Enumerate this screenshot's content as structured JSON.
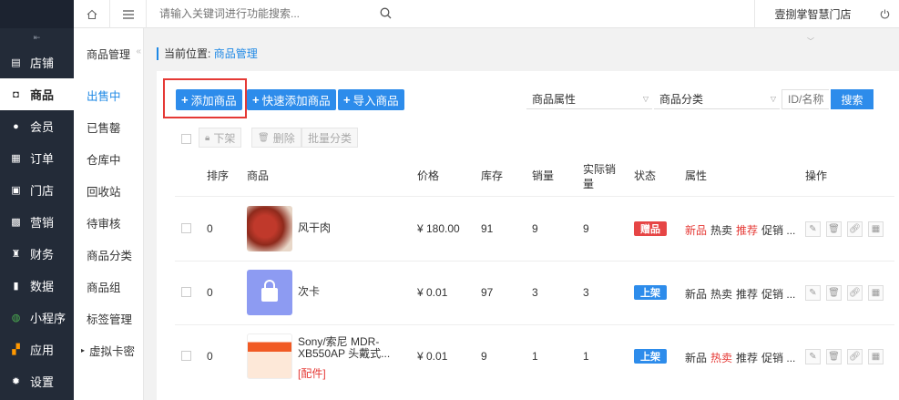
{
  "topbar": {
    "home_icon": "home-icon",
    "menu_icon": "hamburger-icon",
    "search_placeholder": "请输入关键词进行功能搜索...",
    "store_name": "壹捌掌智慧门店"
  },
  "sidebar": {
    "items": [
      {
        "label": "店铺",
        "icon": "store-icon"
      },
      {
        "label": "商品",
        "icon": "goods-icon"
      },
      {
        "label": "会员",
        "icon": "user-icon"
      },
      {
        "label": "订单",
        "icon": "order-icon"
      },
      {
        "label": "门店",
        "icon": "shop-icon"
      },
      {
        "label": "营销",
        "icon": "gift-icon"
      },
      {
        "label": "财务",
        "icon": "money-bag-icon"
      },
      {
        "label": "数据",
        "icon": "chart-icon"
      },
      {
        "label": "小程序",
        "icon": "miniapp-icon"
      },
      {
        "label": "应用",
        "icon": "apps-icon"
      },
      {
        "label": "设置",
        "icon": "gear-icon"
      }
    ],
    "active": "商品"
  },
  "subnav": {
    "title": "商品管理",
    "items": [
      "出售中",
      "已售罄",
      "仓库中",
      "回收站",
      "待审核",
      "商品分类",
      "商品组",
      "标签管理",
      "虚拟卡密"
    ],
    "active": "出售中"
  },
  "breadcrumb": {
    "prefix": "当前位置:",
    "current": "商品管理"
  },
  "toolbar": {
    "add": "添加商品",
    "quick_add": "快速添加商品",
    "import": "导入商品",
    "attr_select": "商品属性",
    "category_select": "商品分类",
    "id_placeholder": "ID/名称",
    "search": "搜索"
  },
  "bulk": {
    "off_shelf": "下架",
    "delete": "删除",
    "batch_category": "批量分类"
  },
  "table": {
    "headers": {
      "sort": "排序",
      "goods": "商品",
      "price": "价格",
      "stock": "库存",
      "sales": "销量",
      "actual_sales": "实际销量",
      "status": "状态",
      "attrs": "属性",
      "ops": "操作"
    },
    "rows": [
      {
        "sort": "0",
        "name": "风干肉",
        "tag": "",
        "price": "¥ 180.00",
        "stock": "91",
        "sales": "9",
        "actual": "9",
        "status": "赠品",
        "status_color": "#e64545",
        "attrs": [
          {
            "t": "新品",
            "red": true
          },
          {
            "t": "热卖",
            "red": false
          },
          {
            "t": "推荐",
            "red": true
          },
          {
            "t": "促销 ...",
            "red": false
          }
        ]
      },
      {
        "sort": "0",
        "name": "次卡",
        "tag": "",
        "price": "¥ 0.01",
        "stock": "97",
        "sales": "3",
        "actual": "3",
        "status": "上架",
        "status_color": "#2d8ceb",
        "attrs": [
          {
            "t": "新品",
            "red": false
          },
          {
            "t": "热卖",
            "red": false
          },
          {
            "t": "推荐",
            "red": false
          },
          {
            "t": "促销 ...",
            "red": false
          }
        ]
      },
      {
        "sort": "0",
        "name": "Sony/索尼 MDR-XB550AP 头戴式...",
        "tag": "[配件]",
        "price": "¥ 0.01",
        "stock": "9",
        "sales": "1",
        "actual": "1",
        "status": "上架",
        "status_color": "#2d8ceb",
        "attrs": [
          {
            "t": "新品",
            "red": false
          },
          {
            "t": "热卖",
            "red": true
          },
          {
            "t": "推荐",
            "red": false
          },
          {
            "t": "促销 ...",
            "red": false
          }
        ]
      }
    ]
  }
}
